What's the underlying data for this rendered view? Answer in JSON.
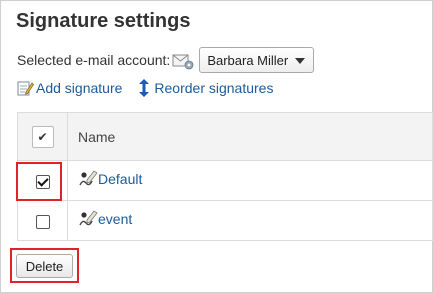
{
  "page": {
    "title": "Signature settings"
  },
  "account": {
    "label": "Selected e-mail account:",
    "selected": "Barbara Miller"
  },
  "actions": {
    "add_signature": "Add signature",
    "reorder_signatures": "Reorder signatures"
  },
  "table": {
    "header_name": "Name",
    "header_checkbox_glyph": "✔",
    "rows": [
      {
        "name": "Default",
        "checked": true
      },
      {
        "name": "event",
        "checked": false
      }
    ]
  },
  "footer": {
    "delete_label": "Delete"
  },
  "colors": {
    "link": "#1a5c9c",
    "highlight": "#e0232b",
    "header_bg": "#f3f3f3"
  }
}
